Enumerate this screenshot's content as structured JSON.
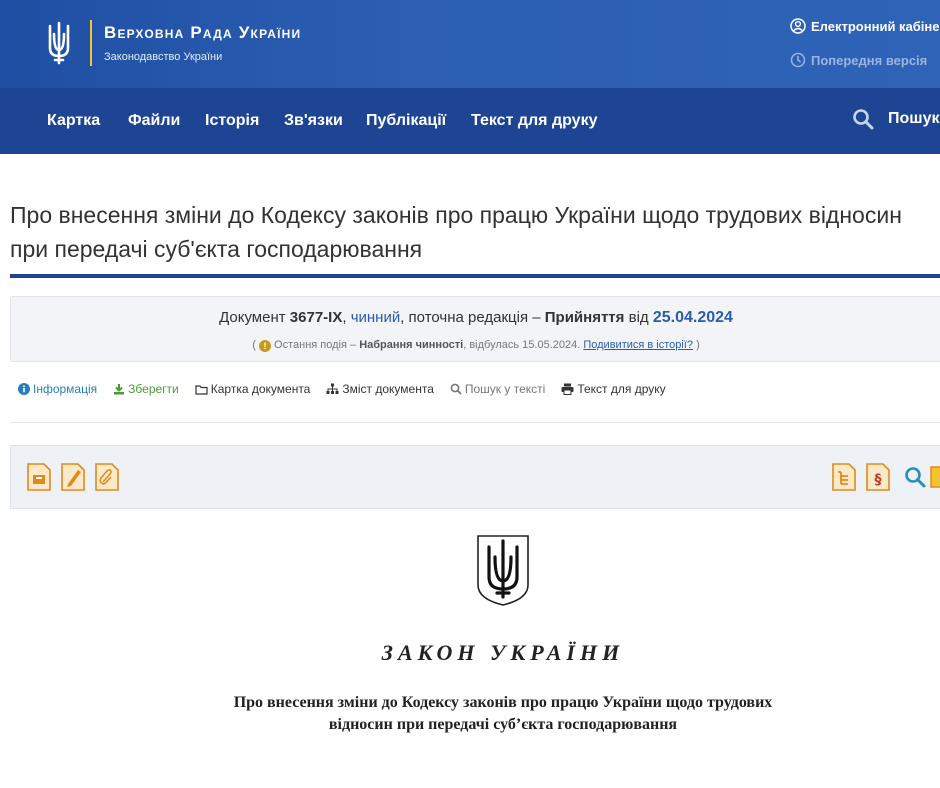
{
  "header": {
    "site_title": "Верховна Рада України",
    "site_subtitle": "Законодавство України",
    "cabinet_link": "Електронний кабіне",
    "prev_version_link": "Попередня версія"
  },
  "nav": {
    "items": [
      "Картка",
      "Файли",
      "Історія",
      "Зв'язки",
      "Публікації",
      "Текст для друку"
    ],
    "search_label": "Пошук"
  },
  "page": {
    "title": "Про внесення зміни до Кодексу законів про працю України щодо трудових відносин при передачі суб'єкта господарювання"
  },
  "document": {
    "label": "Документ",
    "number": "3677-IX",
    "sep1": ",",
    "status": "чинний",
    "edition": ", поточна редакція –",
    "adopted_label": "Прийняття",
    "from_label": "від",
    "adopted_date": "25.04.2024",
    "event_open": "(",
    "event_label": "Остання подія –",
    "event_name": "Набрання чинності",
    "event_happened": ", відбулась 15.05.2024.",
    "history_link": "Подивитися в історії?",
    "event_close": ")"
  },
  "actions": {
    "info": "Інформація",
    "save": "Зберегти",
    "card": "Картка документа",
    "contents": "Зміст документа",
    "search_text": "Пошук у тексті",
    "print": "Текст для друку"
  },
  "law": {
    "heading": "ЗАКОН УКРАЇНИ",
    "subtitle": "Про внесення зміни до Кодексу законів про працю України щодо трудових відносин при передачі суб’єкта господарювання"
  },
  "colors": {
    "header_blue": "#2c5fb4",
    "nav_blue": "#1d4593",
    "accent_yellow": "#f4c430",
    "link_blue": "#2a5cad",
    "toolbar_icon_orange": "#e08a1e"
  }
}
